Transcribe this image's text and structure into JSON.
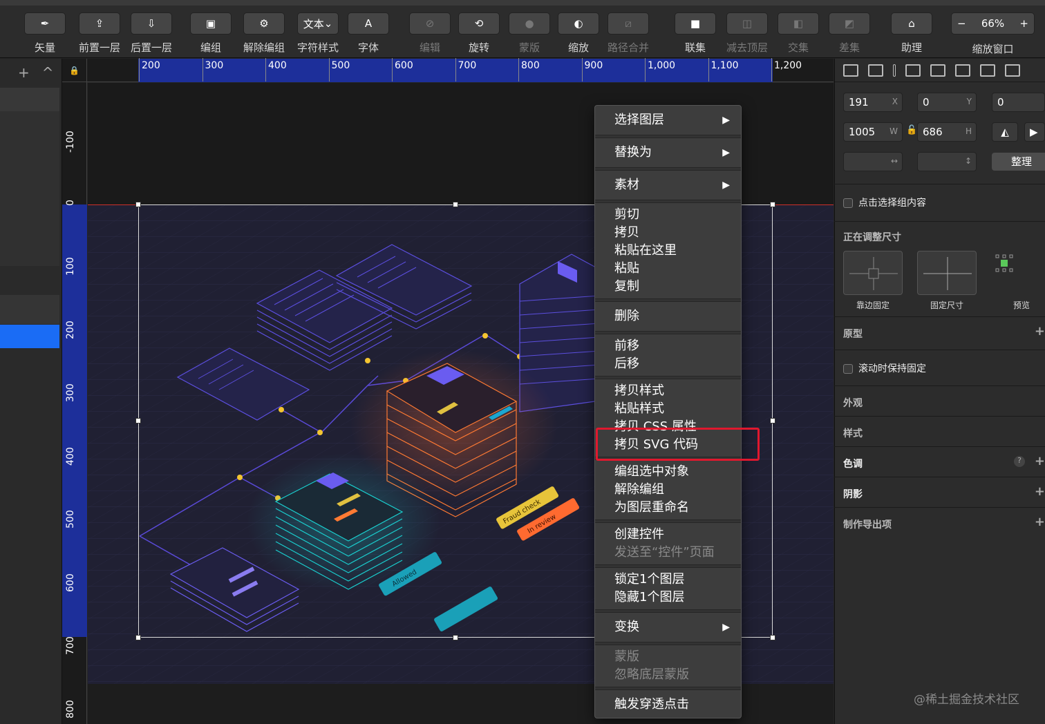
{
  "toolbar": {
    "items": [
      {
        "label": "矢量",
        "icon": "pen-icon"
      },
      {
        "label": "前置一层",
        "icon": "bring-forward-icon"
      },
      {
        "label": "后置一层",
        "icon": "send-backward-icon"
      },
      {
        "label": "编组",
        "icon": "group-icon"
      },
      {
        "label": "解除编组",
        "icon": "ungroup-icon"
      },
      {
        "label": "字符样式",
        "icon": "text-style-icon",
        "button_text": "文本"
      },
      {
        "label": "字体",
        "icon": "font-icon",
        "button_text": "A"
      },
      {
        "label": "编辑",
        "icon": "edit-icon"
      },
      {
        "label": "旋转",
        "icon": "rotate-icon"
      },
      {
        "label": "蒙版",
        "icon": "mask-icon"
      },
      {
        "label": "缩放",
        "icon": "scale-icon"
      },
      {
        "label": "路径合并",
        "icon": "flatten-icon"
      },
      {
        "label": "联集",
        "icon": "union-icon"
      },
      {
        "label": "减去顶层",
        "icon": "subtract-icon"
      },
      {
        "label": "交集",
        "icon": "intersect-icon"
      },
      {
        "label": "差集",
        "icon": "difference-icon"
      },
      {
        "label": "助理",
        "icon": "assistant-icon"
      },
      {
        "label": "缩放窗口",
        "icon": "zoom-icon"
      }
    ],
    "zoom": "66%",
    "zoom_minus": "−",
    "zoom_plus": "+"
  },
  "left_panel": {
    "add": "+",
    "collapse": "^"
  },
  "ruler": {
    "h_labels": [
      "200",
      "300",
      "400",
      "500",
      "600",
      "700",
      "800",
      "900",
      "1,000",
      "1,100",
      "1,200"
    ],
    "v_labels": [
      "-100",
      "0",
      "100",
      "200",
      "300",
      "400",
      "500",
      "600",
      "700",
      "800"
    ]
  },
  "context_menu": {
    "groups": [
      [
        {
          "label": "选择图层",
          "submenu": true
        }
      ],
      [
        {
          "label": "替换为",
          "submenu": true
        }
      ],
      [
        {
          "label": "素材",
          "submenu": true
        }
      ],
      [
        {
          "label": "剪切"
        },
        {
          "label": "拷贝"
        },
        {
          "label": "粘贴在这里"
        },
        {
          "label": "粘贴"
        },
        {
          "label": "复制"
        }
      ],
      [
        {
          "label": "删除"
        }
      ],
      [
        {
          "label": "前移"
        },
        {
          "label": "后移"
        }
      ],
      [
        {
          "label": "拷贝样式"
        },
        {
          "label": "粘贴样式"
        },
        {
          "label": "拷贝 CSS 属性"
        },
        {
          "label": "拷贝 SVG 代码"
        }
      ],
      [
        {
          "label": "编组选中对象"
        },
        {
          "label": "解除编组"
        },
        {
          "label": "为图层重命名"
        }
      ],
      [
        {
          "label": "创建控件"
        },
        {
          "label": "发送至“控件”页面",
          "disabled": true
        }
      ],
      [
        {
          "label": "锁定1个图层"
        },
        {
          "label": "隐藏1个图层"
        }
      ],
      [
        {
          "label": "变换",
          "submenu": true
        }
      ],
      [
        {
          "label": "蒙版",
          "disabled": true
        },
        {
          "label": "忽略底层蒙版",
          "disabled": true
        }
      ],
      [
        {
          "label": "触发穿透点击"
        }
      ]
    ],
    "arrow": "▶"
  },
  "inspector": {
    "x": "191",
    "x_sfx": "X",
    "y": "0",
    "y_sfx": "Y",
    "rot": "0",
    "w": "1005",
    "w_sfx": "W",
    "h": "686",
    "h_sfx": "H",
    "tidy": "整理",
    "click_select": "点击选择组内容",
    "resizing": "正在调整尺寸",
    "pin_edges": "靠边固定",
    "fix_size": "固定尺寸",
    "preview": "预览",
    "prototype": "原型",
    "fix_scroll": "滚动时保持固定",
    "appearance": "外观",
    "style": "样式",
    "tint": "色调",
    "tint_help": "?",
    "shadow": "阴影",
    "export": "制作导出项",
    "plus": "+"
  },
  "illustration_tags": {
    "fraud": "Fraud check",
    "review": "In review",
    "allowed": "Allowed"
  },
  "watermark": "@稀土掘金技术社区",
  "colors": {
    "accent": "#1a6cf5",
    "highlight": "#e0182e",
    "ruler_sel": "#1d2f9a"
  }
}
